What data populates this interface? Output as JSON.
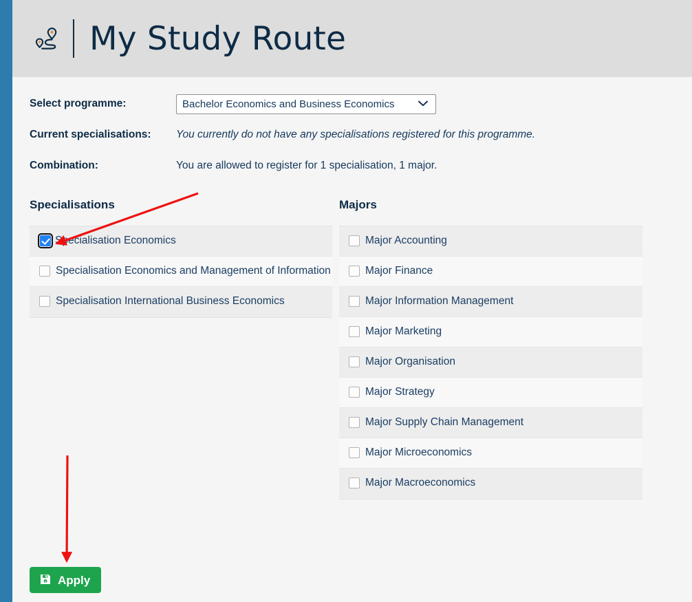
{
  "header": {
    "icon": "route-map-pins-icon",
    "title": "My Study Route"
  },
  "form": {
    "programme_label": "Select programme:",
    "programme_value": "Bachelor Economics and Business Economics",
    "programme_options": [
      "Bachelor Economics and Business Economics"
    ],
    "current_specialisations_label": "Current specialisations:",
    "current_specialisations_value": "You currently do not have any specialisations registered for this programme.",
    "combination_label": "Combination:",
    "combination_value": "You are allowed to register for 1 specialisation, 1 major."
  },
  "specialisations": {
    "heading": "Specialisations",
    "items": [
      {
        "label": "Specialisation Economics",
        "checked": true
      },
      {
        "label": "Specialisation Economics and Management of Information",
        "checked": false
      },
      {
        "label": "Specialisation International Business Economics",
        "checked": false
      }
    ]
  },
  "majors": {
    "heading": "Majors",
    "items": [
      {
        "label": "Major Accounting",
        "checked": false
      },
      {
        "label": "Major Finance",
        "checked": false
      },
      {
        "label": "Major Information Management",
        "checked": false
      },
      {
        "label": "Major Marketing",
        "checked": false
      },
      {
        "label": "Major Organisation",
        "checked": false
      },
      {
        "label": "Major Strategy",
        "checked": false
      },
      {
        "label": "Major Supply Chain Management",
        "checked": false
      },
      {
        "label": "Major Microeconomics",
        "checked": false
      },
      {
        "label": "Major Macroeconomics",
        "checked": false
      }
    ]
  },
  "apply": {
    "label": "Apply",
    "icon": "save-floppy-icon"
  },
  "annotations": {
    "arrow_to_checkbox": "red-arrow-pointing-to-specialisation-economics-checkbox",
    "arrow_to_apply": "red-arrow-pointing-to-apply-button"
  },
  "colors": {
    "rail_blue": "#2d7cae",
    "header_gray": "#dddddd",
    "body_gray": "#f5f5f5",
    "text_navy": "#0d2b45",
    "row_odd": "#ededed",
    "row_even": "#f8f8f8",
    "checkbox_blue": "#2481f5",
    "apply_green": "#1ea44d",
    "annotation_red": "#ee1111"
  }
}
